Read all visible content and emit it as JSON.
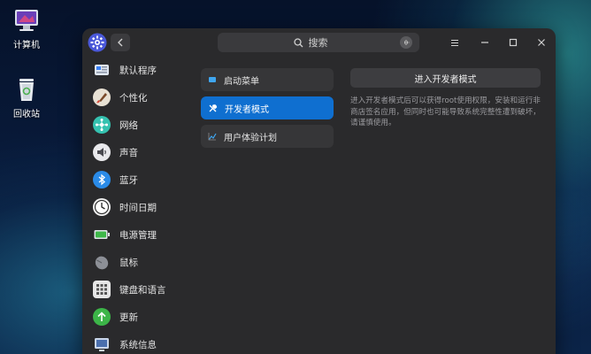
{
  "desktop": {
    "computer_label": "计算机",
    "trash_label": "回收站"
  },
  "titlebar": {
    "search_placeholder": "搜索"
  },
  "sidebar": {
    "items": [
      {
        "label": "默认程序",
        "icon": "default-apps-icon"
      },
      {
        "label": "个性化",
        "icon": "personalization-icon"
      },
      {
        "label": "网络",
        "icon": "network-icon"
      },
      {
        "label": "声音",
        "icon": "sound-icon"
      },
      {
        "label": "蓝牙",
        "icon": "bluetooth-icon"
      },
      {
        "label": "时间日期",
        "icon": "clock-icon"
      },
      {
        "label": "电源管理",
        "icon": "battery-icon"
      },
      {
        "label": "鼠标",
        "icon": "mouse-icon"
      },
      {
        "label": "键盘和语言",
        "icon": "keyboard-icon"
      },
      {
        "label": "更新",
        "icon": "update-icon"
      },
      {
        "label": "系统信息",
        "icon": "system-info-icon"
      }
    ]
  },
  "middle": {
    "items": [
      {
        "label": "启动菜单",
        "icon": "boot-menu-icon"
      },
      {
        "label": "开发者模式",
        "icon": "tools-icon",
        "active": true
      },
      {
        "label": "用户体验计划",
        "icon": "chart-trend-icon"
      }
    ]
  },
  "developer": {
    "button_label": "进入开发者模式",
    "description": "进入开发者模式后可以获得root使用权限，安装和运行非商店签名应用，但同时也可能导致系统完整性遭到破坏，请谨慎使用。"
  },
  "colors": {
    "accent": "#0f6fd0",
    "window_bg": "#2a2a2c"
  }
}
